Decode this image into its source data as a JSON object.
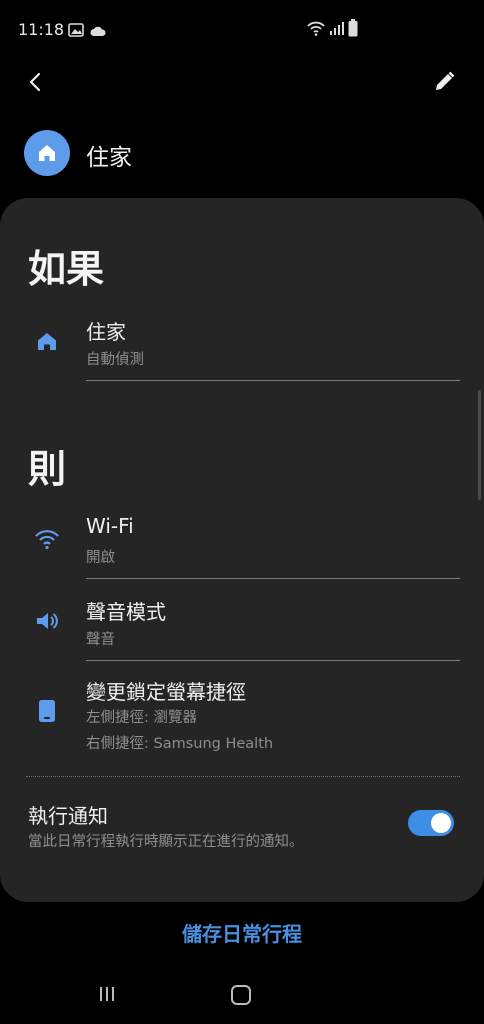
{
  "status_bar": {
    "time": "11:18"
  },
  "header": {
    "title": "住家"
  },
  "if_section": {
    "heading": "如果",
    "condition": {
      "title": "住家",
      "subtitle": "自動偵測"
    }
  },
  "then_section": {
    "heading": "則",
    "actions": [
      {
        "title": "Wi-Fi",
        "subtitle": "開啟"
      },
      {
        "title": "聲音模式",
        "subtitle": "聲音"
      },
      {
        "title": "變更鎖定螢幕捷徑",
        "subtitle_1": "左側捷徑: 瀏覽器",
        "subtitle_2": "右側捷徑: Samsung Health"
      }
    ]
  },
  "notification": {
    "title": "執行通知",
    "description": "當此日常行程執行時顯示正在進行的通知。",
    "enabled": true
  },
  "footer": {
    "save_label": "儲存日常行程"
  },
  "colors": {
    "accent": "#4a8fe0",
    "icon_blue": "#5e9bea",
    "panel": "#252525",
    "background": "#000000"
  }
}
